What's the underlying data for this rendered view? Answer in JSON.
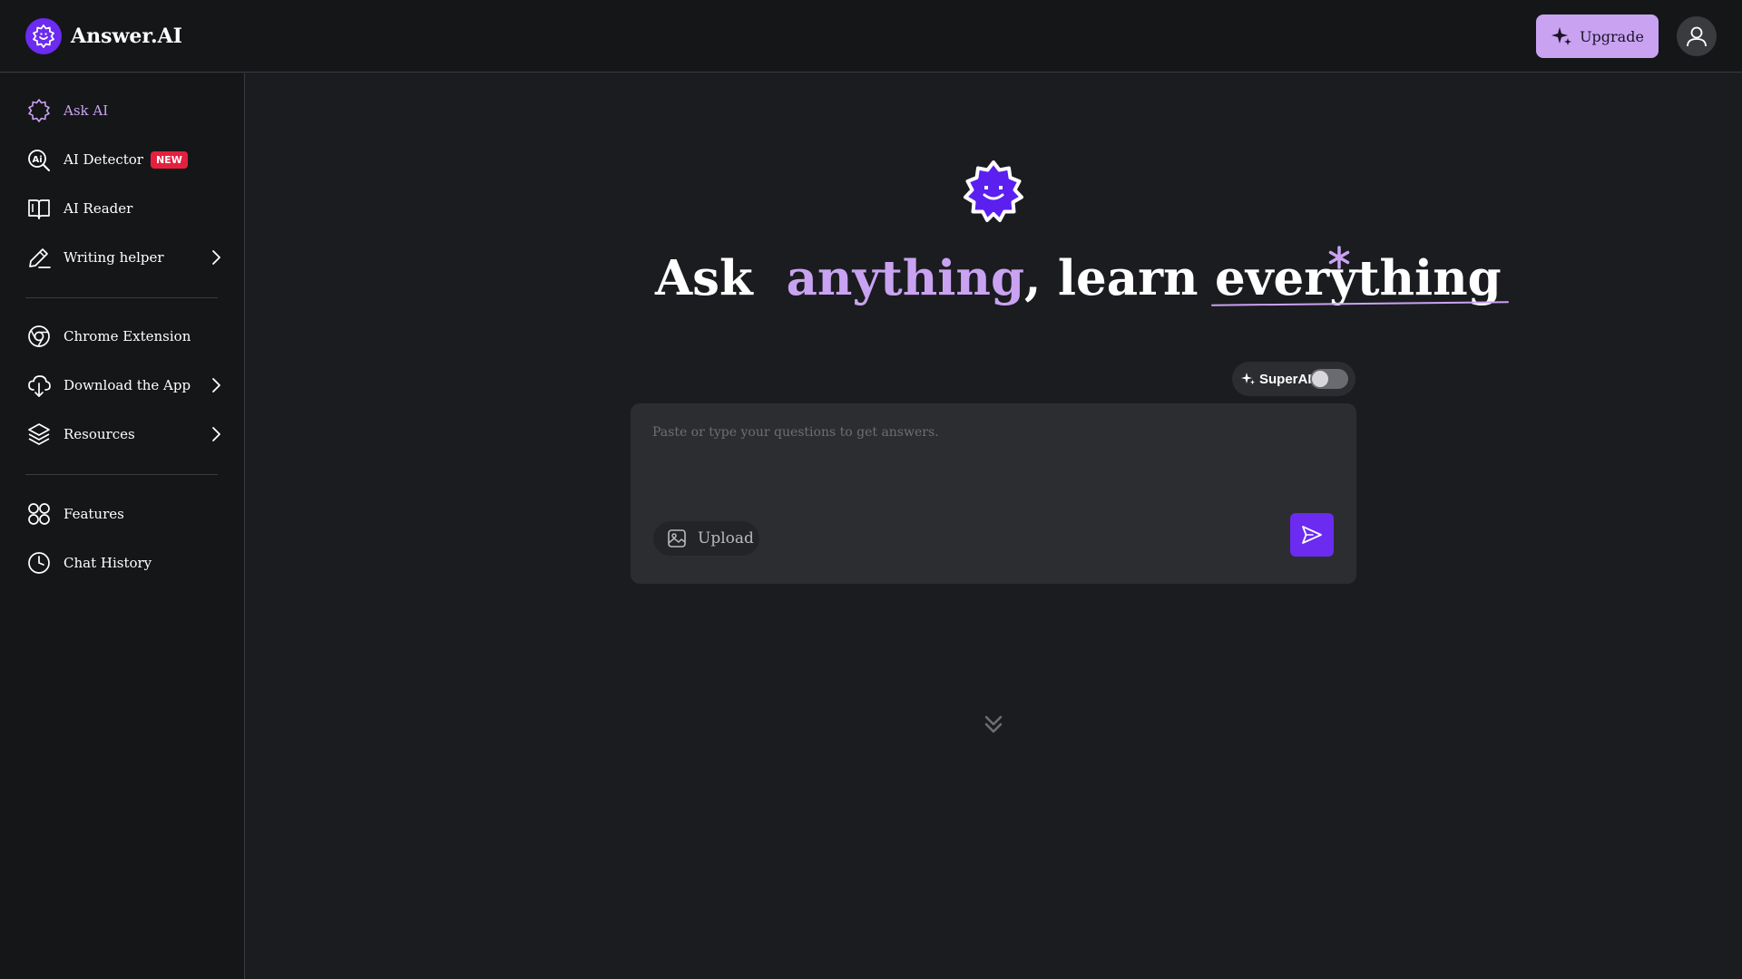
{
  "brand": {
    "name": "Answer.AI"
  },
  "header": {
    "upgrade_label": "Upgrade"
  },
  "sidebar": {
    "items": [
      {
        "label": "Ask AI",
        "icon": "ask-ai-icon",
        "active": true
      },
      {
        "label": "AI Detector",
        "icon": "ai-detector-icon",
        "badge": "NEW"
      },
      {
        "label": "AI Reader",
        "icon": "book-icon"
      },
      {
        "label": "Writing helper",
        "icon": "pen-icon",
        "has_submenu": true
      },
      {
        "label": "Chrome Extension",
        "icon": "chrome-icon"
      },
      {
        "label": "Download the App",
        "icon": "download-icon",
        "has_submenu": true
      },
      {
        "label": "Resources",
        "icon": "layers-icon",
        "has_submenu": true
      },
      {
        "label": "Features",
        "icon": "grid-circles-icon"
      },
      {
        "label": "Chat History",
        "icon": "clock-icon"
      }
    ]
  },
  "hero": {
    "word1": "Ask",
    "word2": "anything",
    "comma": ",",
    "word3": "learn",
    "word4": "everything"
  },
  "superai": {
    "label": "SuperAI",
    "enabled": false
  },
  "ask_box": {
    "placeholder": "Paste or type your questions to get answers.",
    "value": "",
    "upload_label": "Upload"
  },
  "colors": {
    "accent": "#c9a3f2",
    "brand_purple": "#6b2bf0",
    "badge_red": "#e5203f",
    "background": "#1b1c1f",
    "sidebar": "#151618"
  }
}
